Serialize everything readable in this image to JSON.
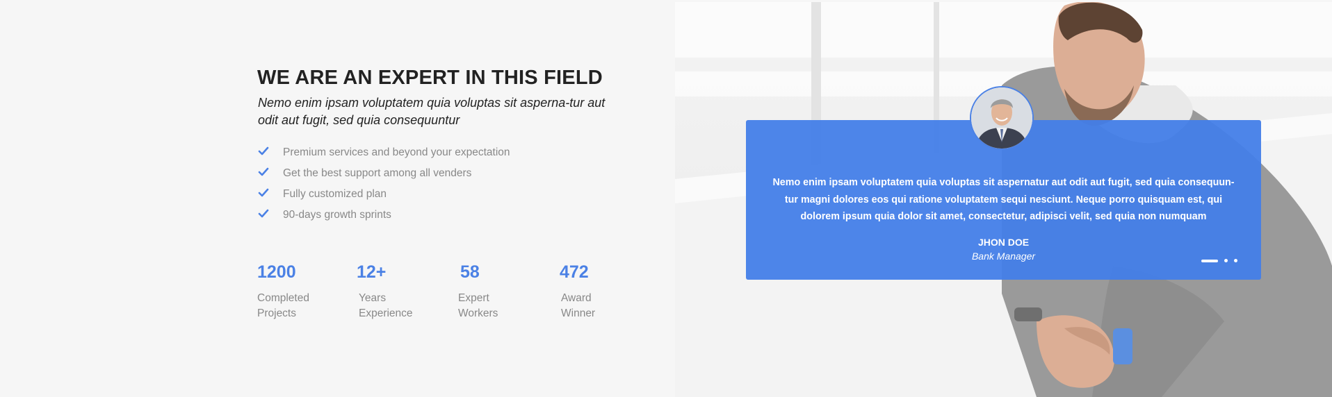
{
  "about": {
    "heading": "WE ARE AN EXPERT IN THIS FIELD",
    "subheading": "Nemo enim ipsam voluptatem quia voluptas sit asperna-tur aut odit aut fugit, sed quia consequuntur",
    "features": [
      "Premium services and beyond your expectation",
      "Get the best support among all venders",
      "Fully customized plan",
      "90-days growth sprints"
    ]
  },
  "stats": [
    {
      "number": "1200",
      "line1": "Completed",
      "line2": "Projects"
    },
    {
      "number": "12+",
      "line1": "Years",
      "line2": "Experience"
    },
    {
      "number": "58",
      "line1": "Expert",
      "line2": "Workers"
    },
    {
      "number": "472",
      "line1": "Award",
      "line2": "Winner"
    }
  ],
  "testimonial": {
    "quote": "Nemo enim ipsam voluptatem quia voluptas sit aspernatur aut odit aut fugit, sed quia consequun-tur magni dolores eos qui ratione voluptatem sequi nesciunt. Neque porro quisquam est, qui dolorem ipsum quia dolor sit amet, consectetur, adipisci velit, sed quia non numquam",
    "name": "JHON DOE",
    "role": "Bank Manager",
    "active_slide": 1,
    "slide_count": 3
  },
  "colors": {
    "accent": "#4b81e5",
    "heading": "#222222",
    "muted": "#888888",
    "card": "#437ee8"
  },
  "icons": {
    "feature_bullet": "check-icon",
    "testimonial_avatar": "avatar-photo"
  }
}
